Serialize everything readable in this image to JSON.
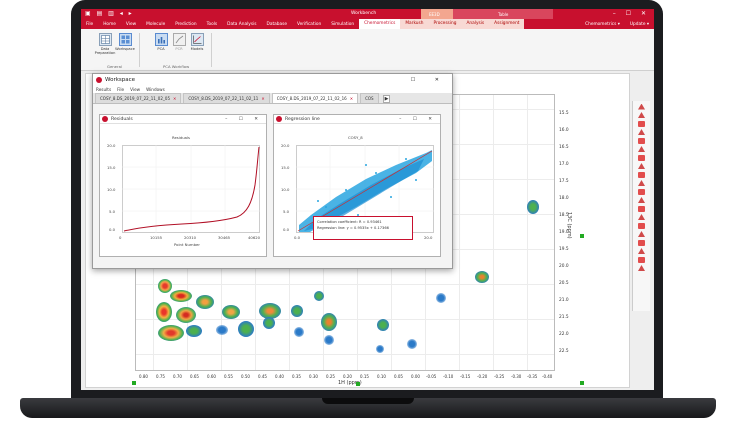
{
  "app": {
    "title": "Workbench",
    "window_controls": "– ☐ ✕",
    "contextual_tabs": [
      "EE3D",
      "Table"
    ]
  },
  "menubar": {
    "tabs": [
      "File",
      "Home",
      "View",
      "Molecule",
      "Prediction",
      "Tools",
      "Data Analysis",
      "Database",
      "Verification",
      "Simulation",
      "Chemometrics",
      "Markush",
      "Processing",
      "Analysis",
      "Assignment"
    ],
    "active_index": 10,
    "right_items": [
      "Chemometrics ▾",
      "Update ▾"
    ]
  },
  "ribbon": {
    "buttons": [
      {
        "label": "Data Preparation"
      },
      {
        "label": "Workspace"
      },
      {
        "label": "PCA"
      },
      {
        "label": "PCR"
      },
      {
        "label": "Models"
      }
    ],
    "groups": [
      "General",
      "PCA Workflow"
    ]
  },
  "plot": {
    "x_axis_title": "1H (ppm)",
    "y_axis_title": "13C (ppm)",
    "x_ticks": [
      "0.80",
      "0.75",
      "0.70",
      "0.65",
      "0.60",
      "0.55",
      "0.50",
      "0.45",
      "0.40",
      "0.35",
      "0.30",
      "0.25",
      "0.20",
      "0.15",
      "0.10",
      "0.05",
      "0.00",
      "-0.05",
      "-0.10",
      "-0.15",
      "-0.20",
      "-0.25",
      "-0.30",
      "-0.35",
      "-0.40"
    ],
    "y_ticks": [
      "15.5",
      "16.0",
      "16.5",
      "17.0",
      "17.5",
      "18.0",
      "18.5",
      "19.0",
      "19.5",
      "20.0",
      "20.5",
      "21.0",
      "21.5",
      "22.0",
      "22.5"
    ]
  },
  "workspace": {
    "title": "Workspace",
    "menu": [
      "Results",
      "File",
      "View",
      "Windows"
    ],
    "tabs": [
      {
        "label": "COSY_8.DS_2019_07_22_11_02_05"
      },
      {
        "label": "COSY_8.DS_2019_07_22_11_02_11"
      },
      {
        "label": "COSY_8.DS_2019_07_22_11_02_16"
      },
      {
        "label": "COS"
      }
    ],
    "active_tab": 2,
    "residuals": {
      "title": "Residuals",
      "chart_title": "Residuals",
      "x_title": "Point Number",
      "x_ticks": [
        "0",
        "10155",
        "20310",
        "30465",
        "40620"
      ],
      "y_ticks": [
        "20.0",
        "15.0",
        "10.0",
        "5.0",
        "0.0"
      ]
    },
    "regression": {
      "title": "Regression line",
      "chart_title": "COSY_8",
      "y_ticks": [
        "20.0",
        "15.0",
        "10.0",
        "5.0",
        "0.0"
      ],
      "x_ticks": [
        "0.0",
        "5.0",
        "10.0",
        "15.0",
        "20.0"
      ],
      "callout_line1": "Correlation coefficient: R = 0.93461",
      "callout_line2": "Regression line: y = 0.9535x + 0.17366"
    }
  }
}
